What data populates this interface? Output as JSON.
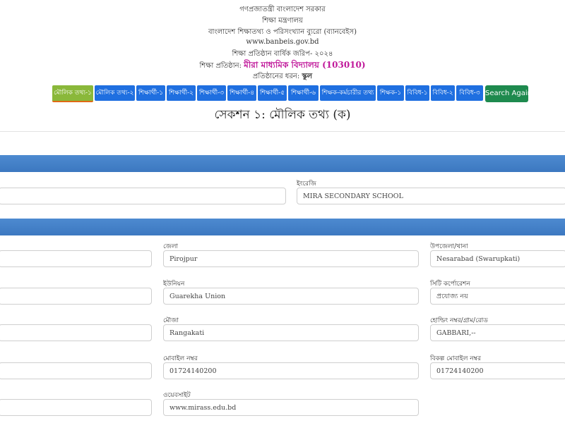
{
  "header": {
    "gov": "গণপ্রজাতন্ত্রী বাংলাদেশ সরকার",
    "ministry": "শিক্ষা মন্ত্রণালয়",
    "bureau": "বাংলাদেশ শিক্ষাতথ্য ও পরিসংখ্যান ব্যুরো (ব্যানবেইস)",
    "website": "www.banbeis.gov.bd",
    "survey": "শিক্ষা প্রতিষ্ঠান বার্ষিক জরিপ- ২০২৪",
    "institution_label": "শিক্ষা প্রতিষ্ঠান:",
    "institution_name": "মীরা মাধ্যমিক বিদ্যালয় (103010)",
    "type_label": "প্রতিষ্ঠানের ধরন:",
    "type_value": "স্কুল"
  },
  "tabs": [
    {
      "label": "মৌলিক তথ্য-১",
      "active": true
    },
    {
      "label": "মৌলিক তথ্য-২"
    },
    {
      "label": "শিক্ষার্থী-১"
    },
    {
      "label": "শিক্ষার্থী-২"
    },
    {
      "label": "শিক্ষার্থী-৩"
    },
    {
      "label": "শিক্ষার্থী-৪"
    },
    {
      "label": "শিক্ষার্থী-৫"
    },
    {
      "label": "শিক্ষার্থী-৬"
    },
    {
      "label": "শিক্ষক-কর্মচারীর তথ্য"
    },
    {
      "label": "শিক্ষক-১"
    },
    {
      "label": "বিবিধ-১"
    },
    {
      "label": "বিবিধ-২"
    },
    {
      "label": "বিবিধ-৩"
    }
  ],
  "search_button": "Search Again",
  "section_title": "সেকশন ১: মৌলিক তথ্য (ক)",
  "fields": {
    "english_label": "ইংরেজি",
    "english_value": "MIRA SECONDARY SCHOOL",
    "district_label": "জেলা",
    "district_value": "Pirojpur",
    "upazila_label": "উপজেলা/থানা",
    "upazila_value": "Nesarabad (Swarupkati)",
    "union_label": "ইউনিয়ন",
    "union_value": "Guarekha Union",
    "city_label": "সিটি কর্পোরেশন",
    "city_value": "প্রযোজ্য নয়",
    "mouza_label": "মৌজা",
    "mouza_value": "Rangakati",
    "holding_label": "হোল্ডিং নম্বর/গ্রাম/রোড",
    "holding_value": "GABBARI,--",
    "mobile_label": "মোবাইল নম্বর",
    "mobile_value": "01724140200",
    "alt_mobile_label": "বিকল্প মোবাইল নম্বর",
    "alt_mobile_value": "01724140200",
    "website_label": "ওয়েবসাইট",
    "website_value": "www.mirass.edu.bd"
  },
  "colors": {
    "tab": "#1f6fe0",
    "tab_active": "#8ab83a",
    "search": "#1e8a4e",
    "band": "#4d8ad0",
    "institution": "#c0189a"
  }
}
